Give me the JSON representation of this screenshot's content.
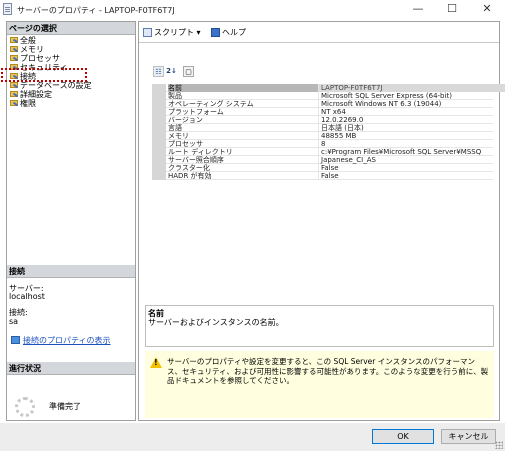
{
  "window": {
    "title": "サーバーのプロパティ - LAPTOP-F0TF6T7J",
    "minimize": "—",
    "maximize": "☐",
    "close": "✕"
  },
  "left": {
    "page_header": "ページの選択",
    "pages": [
      {
        "label": "全般"
      },
      {
        "label": "メモリ"
      },
      {
        "label": "プロセッサ"
      },
      {
        "label": "セキュリティ"
      },
      {
        "label": "接続"
      },
      {
        "label": "データベースの設定"
      },
      {
        "label": "詳細設定"
      },
      {
        "label": "権限"
      }
    ],
    "connection_header": "接続",
    "server_label": "サーバー:",
    "server_value": "localhost",
    "connection_label": "接続:",
    "connection_value": "sa",
    "view_props_link": "接続のプロパティの表示",
    "progress_header": "進行状況",
    "progress_status": "準備完了"
  },
  "toolbar": {
    "script_label": "スクリプト",
    "script_dropdown": "▾",
    "help_label": "ヘルプ"
  },
  "grid_tools": {
    "categorized": "☷",
    "alphabetical": "2↓",
    "property_pages": "▢"
  },
  "properties": [
    {
      "name": "名前",
      "value": "LAPTOP-F0TF6T7J"
    },
    {
      "name": "製品",
      "value": "Microsoft SQL Server Express (64-bit)"
    },
    {
      "name": "オペレーティング システム",
      "value": "Microsoft Windows NT 6.3 (19044)"
    },
    {
      "name": "プラットフォーム",
      "value": "NT x64"
    },
    {
      "name": "バージョン",
      "value": "12.0.2269.0"
    },
    {
      "name": "言語",
      "value": "日本語 (日本)"
    },
    {
      "name": "メモリ",
      "value": "48855 MB"
    },
    {
      "name": "プロセッサ",
      "value": "8"
    },
    {
      "name": "ルート ディレクトリ",
      "value": "c:¥Program Files¥Microsoft SQL Server¥MSSQ"
    },
    {
      "name": "サーバー照合順序",
      "value": "Japanese_CI_AS"
    },
    {
      "name": "クラスター化",
      "value": "False"
    },
    {
      "name": "HADR が有効",
      "value": "False"
    }
  ],
  "description": {
    "title": "名前",
    "text": "サーバーおよびインスタンスの名前。"
  },
  "warning": {
    "text": "サーバーのプロパティや設定を変更すると、この SQL Server インスタンスのパフォーマンス、セキュリティ、および可用性に影響する可能性があります。このような変更を行う前に、製品ドキュメントを参照してください。"
  },
  "buttons": {
    "ok": "OK",
    "cancel": "キャンセル"
  },
  "colors": {
    "link": "#1a4fbf",
    "warning_bg": "#ffffe0",
    "highlight": "#c00000"
  }
}
